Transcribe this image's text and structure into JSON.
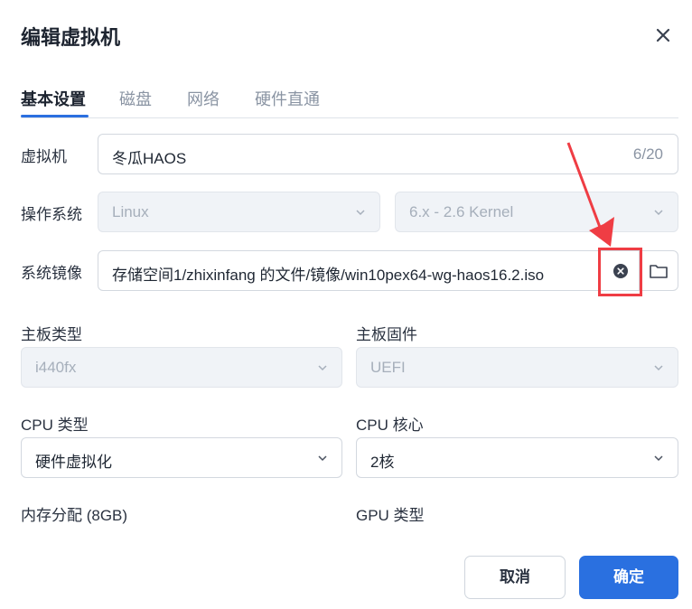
{
  "dialog": {
    "title": "编辑虚拟机"
  },
  "tabs": [
    {
      "label": "基本设置",
      "active": true
    },
    {
      "label": "磁盘",
      "active": false
    },
    {
      "label": "网络",
      "active": false
    },
    {
      "label": "硬件直通",
      "active": false
    }
  ],
  "form": {
    "vm_name": {
      "label": "虚拟机",
      "value": "冬瓜HAOS",
      "counter": "6/20"
    },
    "os": {
      "label": "操作系统",
      "type_value": "Linux",
      "version_value": "6.x - 2.6 Kernel"
    },
    "iso": {
      "label": "系统镜像",
      "value": "存储空间1/zhixinfang 的文件/镜像/win10pex64-wg-haos16.2.iso"
    },
    "board_type": {
      "label": "主板类型",
      "value": "i440fx"
    },
    "board_firmware": {
      "label": "主板固件",
      "value": "UEFI"
    },
    "cpu_type": {
      "label": "CPU 类型",
      "value": "硬件虚拟化"
    },
    "cpu_cores": {
      "label": "CPU 核心",
      "value": "2核"
    },
    "memory": {
      "label": "内存分配 (8GB)"
    },
    "gpu_type": {
      "label": "GPU 类型"
    }
  },
  "footer": {
    "cancel_label": "取消",
    "ok_label": "确定"
  },
  "icons": {
    "close": "close-icon",
    "chevron": "chevron-down-icon",
    "clear": "clear-circle-icon",
    "folder": "folder-icon"
  },
  "colors": {
    "accent": "#2a70e0",
    "annotation": "#ef3d44",
    "disabled_bg": "#f0f3f7"
  }
}
